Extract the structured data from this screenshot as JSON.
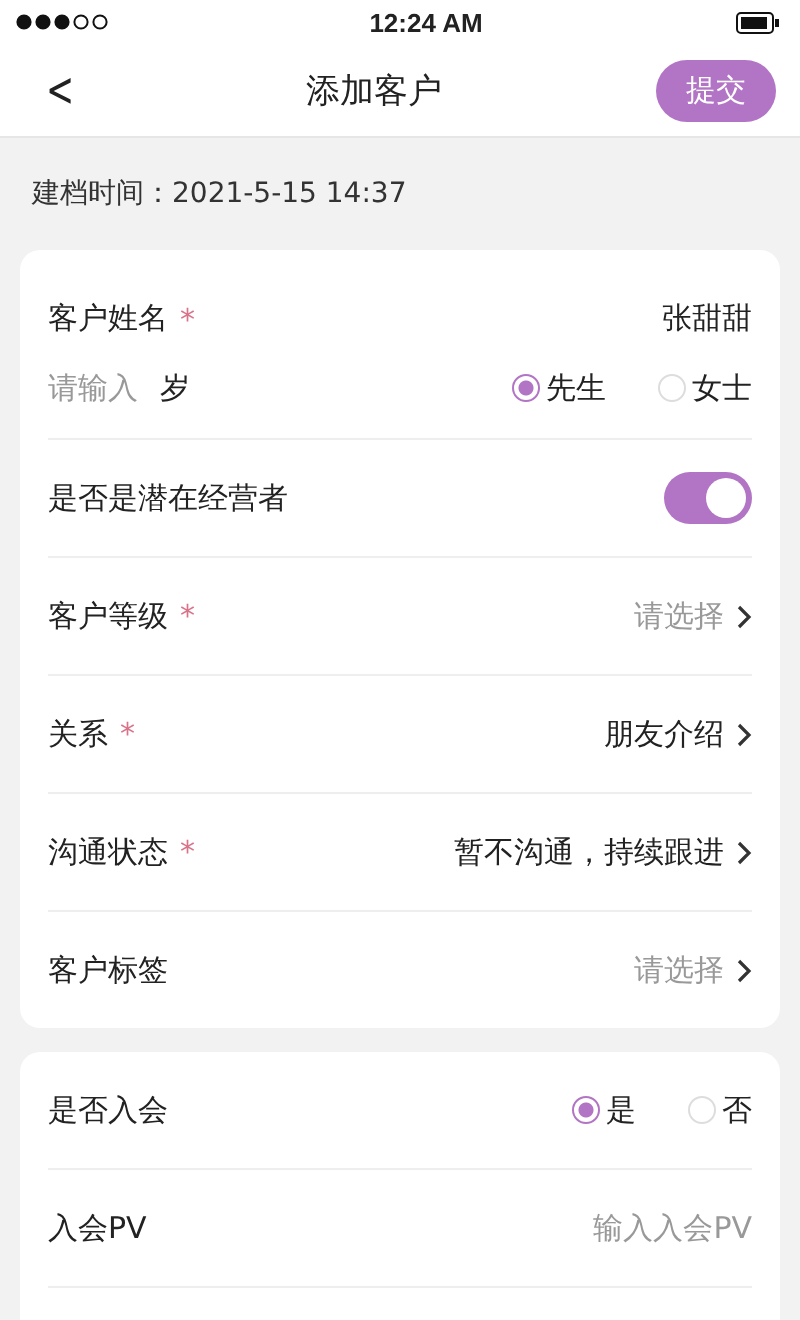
{
  "status_bar": {
    "time": "12:24 AM"
  },
  "nav": {
    "back": "<",
    "title": "添加客户",
    "submit": "提交"
  },
  "created": {
    "label": "建档时间：",
    "value": "2021-5-15 14:37"
  },
  "cards": [
    {
      "rows": [
        {
          "kind": "text",
          "label": "客户姓名",
          "required_mark": "*",
          "value": "张甜甜"
        },
        {
          "kind": "age_gender",
          "placeholder": "请输入",
          "unit": "岁",
          "options": [
            {
              "label": "先生",
              "selected": true
            },
            {
              "label": "女士",
              "selected": false
            }
          ]
        },
        {
          "kind": "toggle",
          "label": "是否是潜在经营者",
          "on": true
        },
        {
          "kind": "select",
          "label": "客户等级",
          "required_mark": "*",
          "placeholder": "请选择"
        },
        {
          "kind": "select",
          "label": "关系",
          "required_mark": "*",
          "value": "朋友介绍"
        },
        {
          "kind": "select",
          "label": "沟通状态",
          "required_mark": "*",
          "value": "暂不沟通，持续跟进"
        },
        {
          "kind": "select",
          "label": "客户标签",
          "placeholder": "请选择"
        }
      ]
    },
    {
      "rows": [
        {
          "kind": "radio",
          "label": "是否入会",
          "options": [
            {
              "label": "是",
              "selected": true
            },
            {
              "label": "否",
              "selected": false
            }
          ]
        },
        {
          "kind": "input",
          "label": "入会PV",
          "placeholder": "输入入会PV"
        }
      ]
    }
  ]
}
